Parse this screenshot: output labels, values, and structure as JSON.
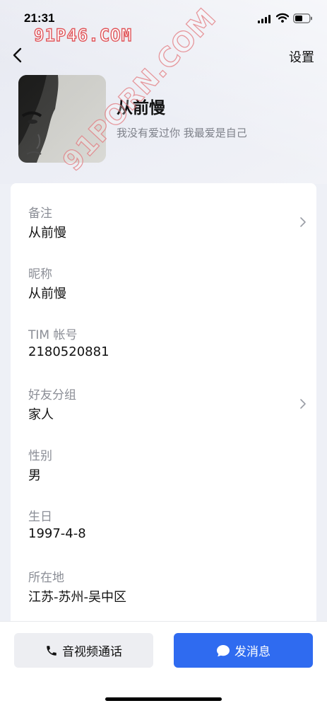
{
  "status_bar": {
    "time": "21:31",
    "icons": [
      "cellular-signal-icon",
      "wifi-icon",
      "battery-icon"
    ]
  },
  "watermarks": {
    "domain": "91P46.COM",
    "diagonal": "91PORN.COM"
  },
  "nav": {
    "back_icon": "chevron-left-icon",
    "settings_label": "设置"
  },
  "profile": {
    "name": "从前慢",
    "signature": "我没有爱过你 我最爱是自己",
    "avatar": "user-photo"
  },
  "info": [
    {
      "label": "备注",
      "value": "从前慢",
      "has_chevron": true
    },
    {
      "label": "昵称",
      "value": "从前慢",
      "has_chevron": false
    },
    {
      "label": "TIM 帐号",
      "value": "2180520881",
      "has_chevron": false
    },
    {
      "label": "好友分组",
      "value": "家人",
      "has_chevron": true
    },
    {
      "label": "性别",
      "value": "男",
      "has_chevron": false
    },
    {
      "label": "生日",
      "value": "1997-4-8",
      "has_chevron": false
    },
    {
      "label": "所在地",
      "value": "江苏-苏州-吴中区",
      "has_chevron": false
    }
  ],
  "actions": {
    "call_label": "音视频通话",
    "call_icon": "phone-icon",
    "message_label": "发消息",
    "message_icon": "chat-bubble-icon"
  },
  "colors": {
    "accent": "#2f6bf0",
    "watermark": "#e0565b",
    "background": "#eef0f6"
  }
}
